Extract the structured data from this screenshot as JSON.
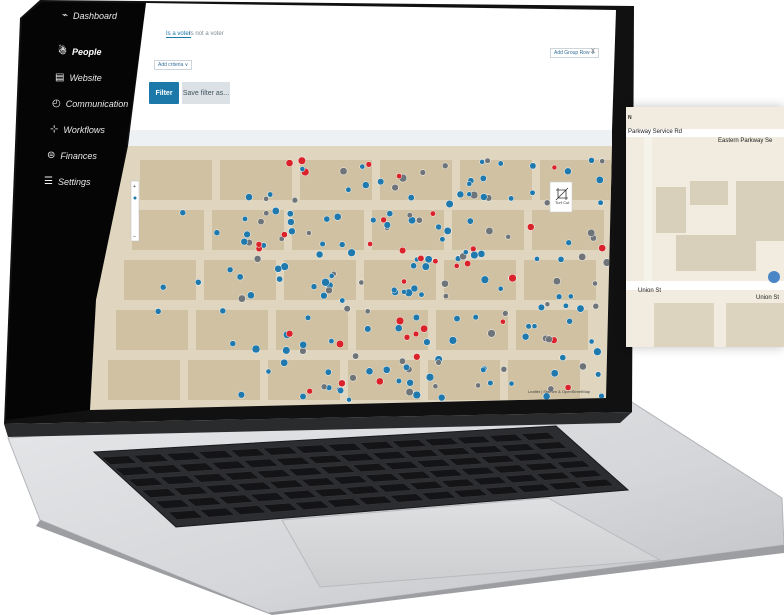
{
  "sidebar": {
    "items": [
      {
        "label": "Dashboard",
        "icon": "dashboard-icon",
        "glyph": "⌁"
      },
      {
        "label": "People",
        "icon": "people-icon",
        "glyph": "☃"
      },
      {
        "label": "Website",
        "icon": "website-icon",
        "glyph": "▤"
      },
      {
        "label": "Communication",
        "icon": "communication-icon",
        "glyph": "◴"
      },
      {
        "label": "Workflows",
        "icon": "workflows-icon",
        "glyph": "⊹"
      },
      {
        "label": "Finances",
        "icon": "finances-icon",
        "glyph": "⊜"
      },
      {
        "label": "Settings",
        "icon": "settings-icon",
        "glyph": "☰"
      }
    ],
    "active": "People"
  },
  "filters": {
    "tabs": [
      "Is a voter",
      "Is not a voter"
    ],
    "add_criteria": "Add criteria ∨",
    "add_group": "Add Group Row ∨",
    "close": "X",
    "filter_button": "Filter",
    "save_button": "Save filter as..."
  },
  "map": {
    "tool_label": "Turf Cut",
    "attribution": "Leaflet | Stamen & OpenStreetMap",
    "dot_colors": {
      "blue": "#1f79ad",
      "gray": "#6e7478",
      "red": "#d9222a"
    }
  },
  "zoom_inset": {
    "labels": [
      "Parkway Service Rd",
      "Eastern Parkway Se",
      "Union St",
      "Union St"
    ],
    "arrow": "N"
  },
  "colors": {
    "sidebar": "#050505",
    "accent": "#1b78a8",
    "map_bg": "#e0d6c0",
    "block": "#cfc1a1"
  }
}
